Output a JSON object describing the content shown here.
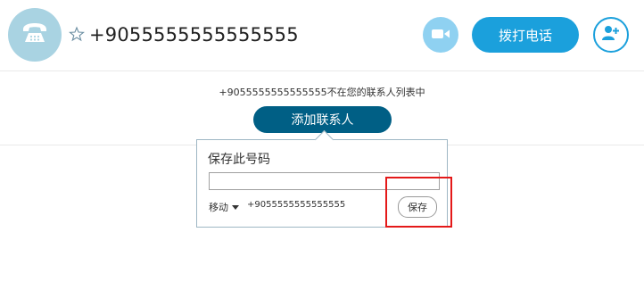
{
  "header": {
    "contact_title": "+9055555555555555",
    "call_label": "拨打电话",
    "icons": {
      "avatar": "phone-icon",
      "favorite": "star-icon",
      "video": "video-camera-icon",
      "add_contact": "add-contact-icon"
    }
  },
  "notice": {
    "text": "+9055555555555555不在您的联系人列表中"
  },
  "add_contact_button": {
    "label": "添加联系人"
  },
  "popup": {
    "title": "保存此号码",
    "input_value": "",
    "phone_type": "移动",
    "number": "+9055555555555555",
    "save_label": "保存"
  },
  "colors": {
    "accent": "#1ba0dc",
    "dark_button": "#005f85",
    "avatar_bg": "#a9d3e2",
    "highlight": "#e41919"
  }
}
